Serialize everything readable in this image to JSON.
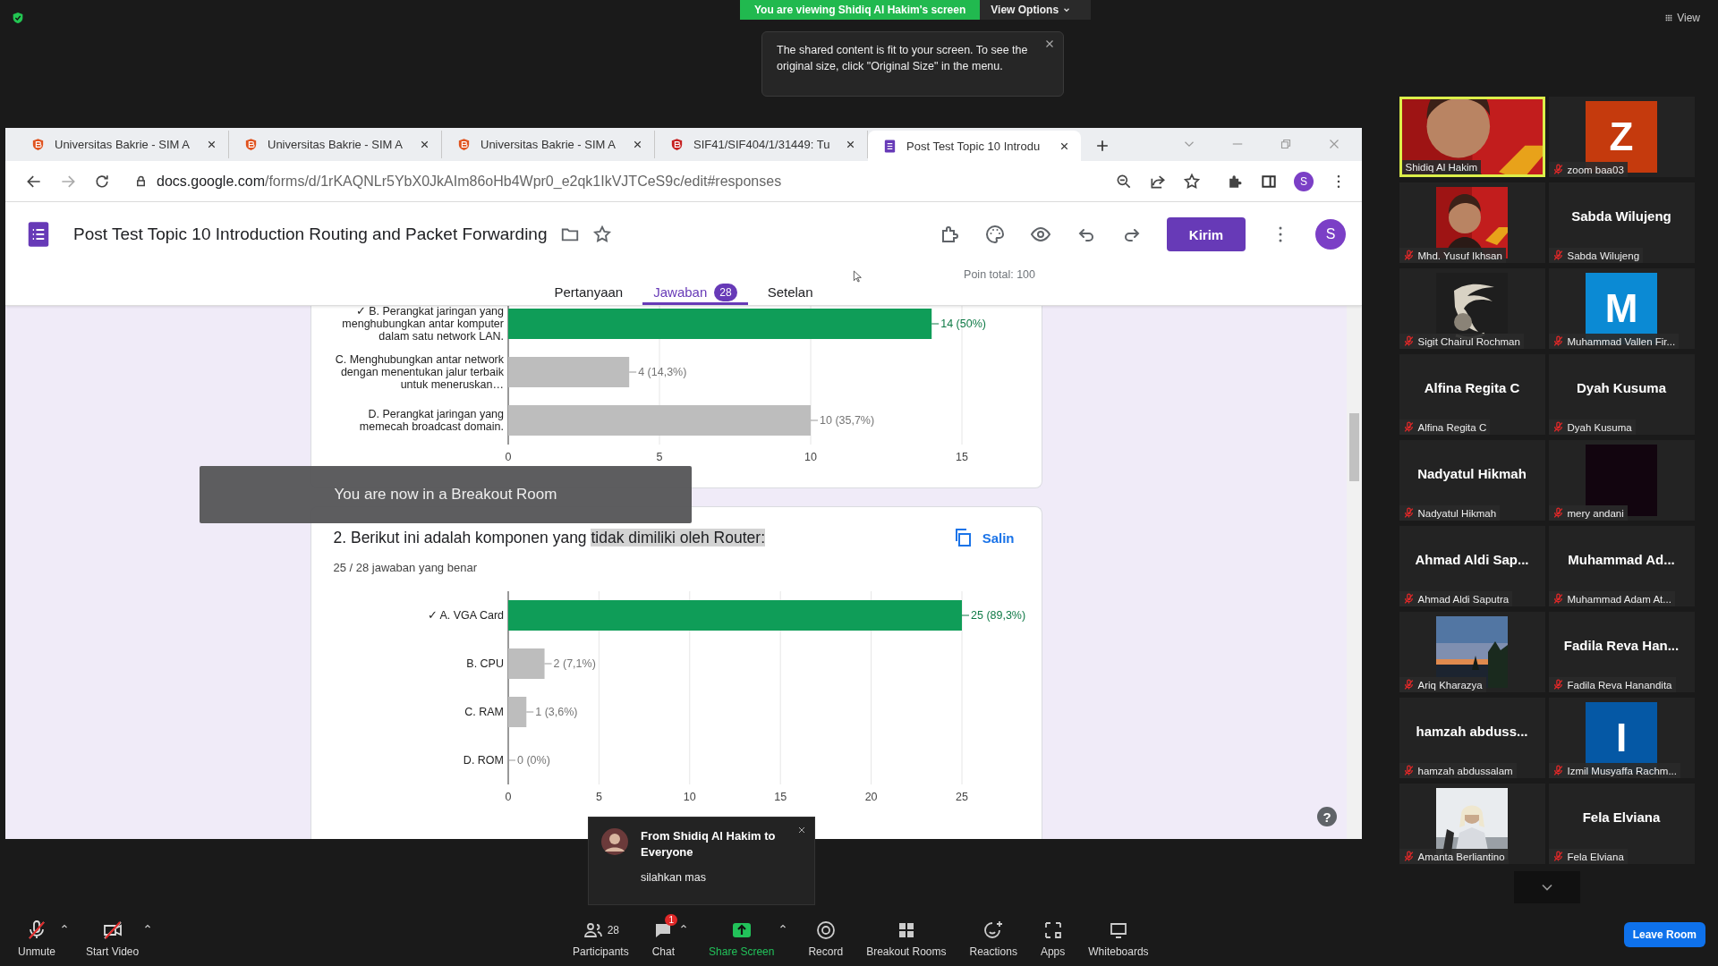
{
  "zoom_top": {
    "banner": "You are viewing Shidiq Al Hakim's screen",
    "view_options": "View Options",
    "view": "View"
  },
  "tooltip": {
    "text": "The shared content is fit to your screen. To see the original size, click \"Original Size\" in the menu."
  },
  "browser": {
    "tabs": [
      {
        "title": "Universitas Bakrie - SIM A",
        "kind": "shield",
        "selected": false
      },
      {
        "title": "Universitas Bakrie - SIM A",
        "kind": "shield",
        "selected": false
      },
      {
        "title": "Universitas Bakrie - SIM A",
        "kind": "shield",
        "selected": false
      },
      {
        "title": "SIF41/SIF404/1/31449: Tu",
        "kind": "shield-dark",
        "selected": false
      },
      {
        "title": "Post Test Topic 10 Introdu",
        "kind": "forms",
        "selected": true
      }
    ],
    "url_host": "docs.google.com",
    "url_path": "/forms/d/1rKAQNLr5YbX0JkAIm86oHb4Wpr0_e2qk1IkVJTCeS9c/edit#responses",
    "profile": "S"
  },
  "form": {
    "title": "Post Test Topic 10 Introduction Routing and Packet Forwarding",
    "send": "Kirim",
    "avatar": "S",
    "tabs": [
      {
        "label": "Pertanyaan",
        "selected": false
      },
      {
        "label": "Jawaban",
        "badge": "28",
        "selected": true
      },
      {
        "label": "Setelan",
        "selected": false
      }
    ],
    "points": "Poin total: 100",
    "help": "?",
    "questions": [
      {
        "correct": [
          true,
          false,
          false
        ],
        "chart_data": {
          "type": "bar",
          "orientation": "horizontal",
          "grid": true,
          "categories": [
            "✓ B. Perangkat jaringan yang menghubungkan antar komputer dalam satu network LAN.",
            "C. Menghubungkan antar network dengan menentukan jalur terbaik untuk meneruskan…",
            "D. Perangkat jaringan yang memecah broadcast domain."
          ],
          "values": [
            14,
            4,
            10
          ],
          "xlim": [
            0,
            15
          ],
          "xticks": [
            0,
            5,
            10,
            15
          ],
          "value_labels": [
            "14 (50%)",
            "4 (14,3%)",
            "10 (35,7%)"
          ]
        }
      },
      {
        "title": "2. Berikut ini adalah komponen yang",
        "title_highlight": "tidak dimiliki oleh Router:",
        "score": "25 / 28 jawaban yang benar",
        "copy_label": "Salin",
        "correct": [
          true,
          false,
          false,
          false
        ],
        "chart_data": {
          "type": "bar",
          "orientation": "horizontal",
          "grid": true,
          "categories": [
            "✓ A. VGA Card",
            "B. CPU",
            "C. RAM",
            "D. ROM"
          ],
          "values": [
            25,
            2,
            1,
            0
          ],
          "xlim": [
            0,
            25
          ],
          "xticks": [
            0,
            5,
            10,
            15,
            20,
            25
          ],
          "value_labels": [
            "25 (89,3%)",
            "2 (7,1%)",
            "1 (3,6%)",
            "0 (0%)"
          ]
        }
      }
    ]
  },
  "breakout": "You are now in a Breakout Room",
  "participants": [
    {
      "name": "Shidiq Al Hakim",
      "kind": "picture",
      "speaking": true,
      "muted": false
    },
    {
      "name": "zoom baa03",
      "kind": "letter",
      "letter": "Z",
      "color": "#c53a0d",
      "speaking": false,
      "muted": true
    },
    {
      "name": "Mhd. Yusuf Ikhsan",
      "kind": "picture",
      "speaking": false,
      "muted": true
    },
    {
      "name": "Sabda Wilujeng",
      "kind": "name",
      "display": "Sabda Wilujeng",
      "speaking": false,
      "muted": true
    },
    {
      "name": "Sigit Chairul Rochman",
      "kind": "picture",
      "speaking": false,
      "muted": true
    },
    {
      "name": "Muhammad Vallen Fir...",
      "kind": "letter",
      "letter": "M",
      "color": "#0b8ad4",
      "speaking": false,
      "muted": true
    },
    {
      "name": "Alfina Regita C",
      "kind": "name",
      "display": "Alfina Regita C",
      "speaking": false,
      "muted": true
    },
    {
      "name": "Dyah Kusuma",
      "kind": "name",
      "display": "Dyah Kusuma",
      "speaking": false,
      "muted": true
    },
    {
      "name": "Nadyatul Hikmah",
      "kind": "name",
      "display": "Nadyatul Hikmah",
      "speaking": false,
      "muted": true
    },
    {
      "name": "mery andani",
      "kind": "blank",
      "speaking": false,
      "muted": true
    },
    {
      "name": "Ahmad Aldi Saputra",
      "kind": "name",
      "display": "Ahmad Aldi Sap...",
      "speaking": false,
      "muted": true
    },
    {
      "name": "Muhammad Adam At...",
      "kind": "name",
      "display": "Muhammad Ad...",
      "speaking": false,
      "muted": true
    },
    {
      "name": "Ariq Kharazya",
      "kind": "picture",
      "speaking": false,
      "muted": true
    },
    {
      "name": "Fadila Reva Hanandita",
      "kind": "name",
      "display": "Fadila Reva Han...",
      "speaking": false,
      "muted": true
    },
    {
      "name": "hamzah abdussalam",
      "kind": "name",
      "display": "hamzah abduss...",
      "speaking": false,
      "muted": true
    },
    {
      "name": "Izmil Musyaffa Rachm...",
      "kind": "letter",
      "letter": "I",
      "color": "#0558a5",
      "speaking": false,
      "muted": true
    },
    {
      "name": "Amanta Berliantino",
      "kind": "picture",
      "speaking": false,
      "muted": true
    },
    {
      "name": "Fela Elviana",
      "kind": "name",
      "display": "Fela Elviana",
      "speaking": false,
      "muted": true
    }
  ],
  "chat_popup": {
    "title": "From Shidiq Al Hakim to Everyone",
    "message": "silahkan mas"
  },
  "toolbar_left": [
    {
      "kind": "mic-off",
      "label": "Unmute",
      "caret": true
    },
    {
      "kind": "video-off",
      "label": "Start Video",
      "caret": true
    }
  ],
  "toolbar": [
    {
      "kind": "participants",
      "label": "Participants",
      "count": "28",
      "caret": false
    },
    {
      "kind": "chat",
      "label": "Chat",
      "badge": "1",
      "caret": true
    },
    {
      "kind": "share",
      "label": "Share Screen",
      "caret": true
    },
    {
      "kind": "record",
      "label": "Record",
      "caret": false
    },
    {
      "kind": "breakout",
      "label": "Breakout Rooms",
      "caret": false
    },
    {
      "kind": "reactions",
      "label": "Reactions",
      "caret": false
    },
    {
      "kind": "apps",
      "label": "Apps",
      "caret": false
    },
    {
      "kind": "whiteboards",
      "label": "Whiteboards",
      "caret": false
    }
  ],
  "leave": "Leave Room"
}
